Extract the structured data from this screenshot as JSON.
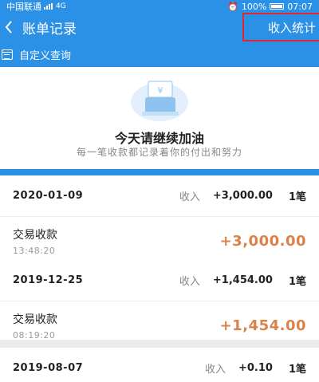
{
  "status_bar": {
    "carrier": "中国联通",
    "network": "4G",
    "battery": "100%",
    "time": "07:07"
  },
  "header": {
    "title": "账单记录",
    "stats_button": "收入统计"
  },
  "query": {
    "label": "自定义查询"
  },
  "hero": {
    "illustration_symbol": "¥",
    "title": "今天请继续加油",
    "subtitle": "每一笔收款都记录着你的付出和努力"
  },
  "groups": [
    {
      "date": "2020-01-09",
      "label": "收入",
      "amount": "+3,000.00",
      "count": "1笔",
      "transactions": [
        {
          "name": "交易收款",
          "time": "13:48:20",
          "amount": "+3,000.00"
        }
      ]
    },
    {
      "date": "2019-12-25",
      "label": "收入",
      "amount": "+1,454.00",
      "count": "1笔",
      "transactions": [
        {
          "name": "交易收款",
          "time": "08:19:20",
          "amount": "+1,454.00"
        }
      ]
    },
    {
      "date": "2019-08-07",
      "label": "收入",
      "amount": "+0.10",
      "count": "1笔",
      "transactions": []
    }
  ],
  "colors": {
    "primary": "#2a91e6",
    "amount": "#d9824a",
    "highlight": "#e5252c"
  }
}
